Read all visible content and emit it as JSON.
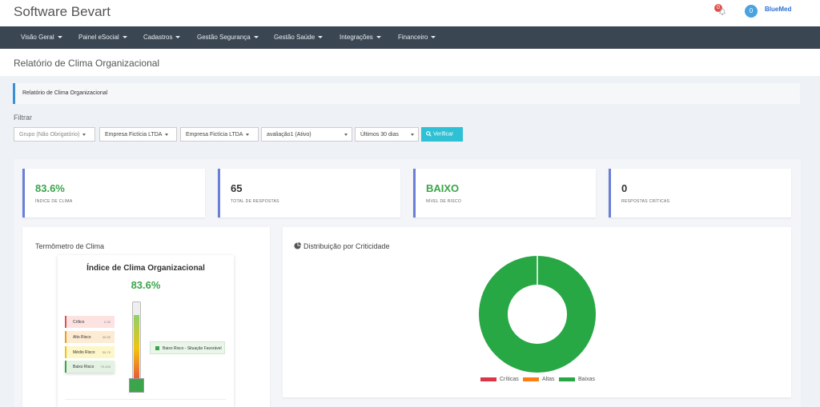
{
  "app": {
    "title": "Software Bevart",
    "notifications": "0",
    "user_initial": "0",
    "brand": "BlueMed"
  },
  "nav": [
    "Visão Geral",
    "Painel eSocial",
    "Cadastros",
    "Gestão Segurança",
    "Gestão Saúde",
    "Integrações",
    "Financeiro"
  ],
  "page": {
    "title": "Relatório de Clima Organizacional",
    "breadcrumb": "Relatório de Clima Organizacional"
  },
  "filters": {
    "label": "Filtrar",
    "grupo": "Grupo (Não Obrigatório)",
    "empresa1": "Empresa Fictícia LTDA",
    "empresa2": "Empresa Fictícia LTDA",
    "avaliacao": "avaliação1 (Ativo)",
    "periodo": "Últimos 30 dias",
    "verify_label": "Verificar"
  },
  "kpis": [
    {
      "value": "83.6%",
      "label": "Índice de Clima"
    },
    {
      "value": "65",
      "label": "Total de Respostas"
    },
    {
      "value": "BAIXO",
      "label": "Nível de Risco"
    },
    {
      "value": "0",
      "label": "Respostas Críticas"
    }
  ],
  "thermometer": {
    "panel_title": "Termômetro de Clima",
    "card_title": "Índice de Clima Organizacional",
    "value": "83.6%",
    "fill_fraction": 0.836,
    "levels": [
      {
        "label": "Crítico",
        "range": "0-30",
        "color": "#fde2e2",
        "border": "#e04f4f"
      },
      {
        "label": "Alto Risco",
        "range": "30-50",
        "color": "#fdebd3",
        "border": "#f39c12"
      },
      {
        "label": "Médio Risco",
        "range": "50-70",
        "color": "#fdf6c9",
        "border": "#f1c40f"
      },
      {
        "label": "Baixo Risco",
        "range": "70-100",
        "color": "#e3f2e3",
        "border": "#3aa54a"
      }
    ],
    "status": "Baixo Risco - Situação Favorável"
  },
  "donut": {
    "title": "Distribuição por Criticidade",
    "legend": [
      {
        "label": "Críticas",
        "color": "#dc3545"
      },
      {
        "label": "Altas",
        "color": "#fd7e14"
      },
      {
        "label": "Baixas",
        "color": "#28a745"
      }
    ]
  },
  "chart_data": {
    "type": "pie",
    "categories": [
      "Críticas",
      "Altas",
      "Baixas"
    ],
    "values": [
      0,
      0,
      65
    ],
    "title": "Distribuição por Criticidade"
  }
}
